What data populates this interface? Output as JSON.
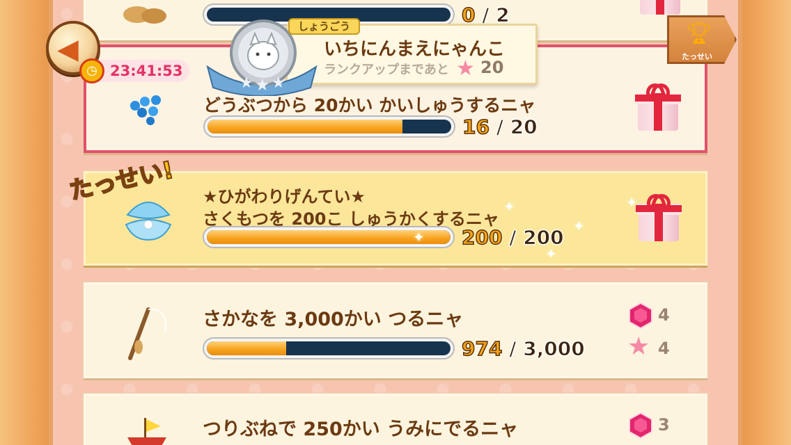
{
  "header": {
    "timer": "23:41:53",
    "rank_tag": "しょうごう",
    "rank_name": "いちにんまえにゃんこ",
    "rank_next_label": "ランクアップまであと",
    "rank_next_count": "20",
    "achieve_label": "たっせい"
  },
  "missions": [
    {
      "title": "",
      "current": "0",
      "sep": " / ",
      "max": "2",
      "progress": 0.0,
      "icon": "peanut-icon"
    },
    {
      "title": "どうぶつから 20かい かいしゅうするニャ",
      "current": "16",
      "sep": " / ",
      "max": "20",
      "progress": 0.8,
      "icon": "blue-beads-icon"
    },
    {
      "title": "★ひがわりげんてい★",
      "subtitle": "さくもつを 200こ しゅうかくするニャ",
      "current": "200",
      "sep": " / ",
      "max": "200",
      "progress": 1.0,
      "badge": "たっせい!",
      "icon": "shell-pearl-icon"
    },
    {
      "title": "さかなを 3,000かい つるニャ",
      "current": "974",
      "sep": " / ",
      "max": "3,000",
      "progress": 0.325,
      "icon": "fishing-rod-icon",
      "reward_gem": "4",
      "reward_star": "4"
    },
    {
      "title": "つりぶねで 250かい うみにでるニャ",
      "reward_gem": "3",
      "icon": "boat-icon"
    }
  ],
  "colors": {
    "accent_red": "#e3506c",
    "progress_fill": "#f7a21d",
    "progress_track": "#17344e",
    "title_brown": "#6b3a12"
  }
}
